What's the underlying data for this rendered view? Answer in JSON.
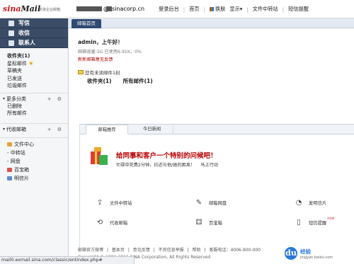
{
  "header": {
    "logo_text": "sina",
    "logo_mail": "Mail",
    "logo_sub": "新浪企业邮箱",
    "at": "@",
    "domain": "sinacorp.cn",
    "links": [
      "登录后台",
      "首页",
      "换肤",
      "显示▾",
      "文件中转站",
      "短信提醒"
    ]
  },
  "sidebar": {
    "write": "写信",
    "inbox": "收信",
    "contacts": "联系人",
    "folders": [
      {
        "label": "收件夹(1)",
        "bold": true
      },
      {
        "label": "星标邮件",
        "star": "★"
      },
      {
        "label": "草稿夹"
      },
      {
        "label": "已发送"
      },
      {
        "label": "垃圾邮件"
      }
    ],
    "more_group": "更多分类",
    "more_tools": "+ ⚙",
    "more_items": [
      "已删除",
      "所有邮件"
    ],
    "agent_group": "代收邮箱",
    "agent_tools": "+ ⚙",
    "tools": [
      {
        "label": "文件中心",
        "color": "#e8a23a"
      },
      {
        "label": "- 中转站",
        "color": ""
      },
      {
        "label": "- 网盘",
        "color": ""
      },
      {
        "label": "百宝箱",
        "color": "#d9534f"
      },
      {
        "label": "明信片",
        "color": "#5b8bd6"
      }
    ]
  },
  "tabstrip": {
    "active": "邮箱首页"
  },
  "main": {
    "greeting": "admin，上午好！",
    "capacity": "邮箱容量:5G 已使用6.91K，0%",
    "feedback": "新新邮箱意见反馈",
    "unread": "您有未读邮件1封",
    "folder_inbox": "收件夹(1)",
    "folder_all": "所有邮件(1)"
  },
  "panel": {
    "tab_recommend": "邮箱推荐",
    "tab_news": "今日新闻",
    "promo_title": "给同事和客户一个特别的问候吧！",
    "promo_sub": "忙碌中花费2分钟，拉近与他/她的距离！",
    "promo_action": "马上行动",
    "tools": {
      "transfer": {
        "label": "文件中转站",
        "icon": "upload-icon"
      },
      "netdisk": {
        "label": "邮箱网盘",
        "icon": "pen-icon"
      },
      "postcard": {
        "label": "发明信片",
        "icon": "postcard-icon"
      },
      "agent": {
        "label": "代收邮箱",
        "icon": "sync-icon"
      },
      "treasure": {
        "label": "百宝箱",
        "icon": "gift-icon"
      },
      "sms": {
        "label": "短信提醒",
        "icon": "phone-icon",
        "badge": "new"
      }
    }
  },
  "footer": {
    "links": [
      "邮箱官方微博",
      "|",
      "基本页",
      "|",
      "意见反馈",
      "|",
      "不良信息举报",
      "|",
      "帮助",
      "|",
      "客服电话：4006-900-000"
    ],
    "copyright": "Copyright © 1996-2015 SINA Corporation, All Rights Reserved"
  },
  "statusbar": {
    "url": "mail0.exmail.sina.com/classic/entindex.php#"
  },
  "watermark": {
    "glyph": "du",
    "text": "经验",
    "url": "jingyan.baidu.com"
  }
}
